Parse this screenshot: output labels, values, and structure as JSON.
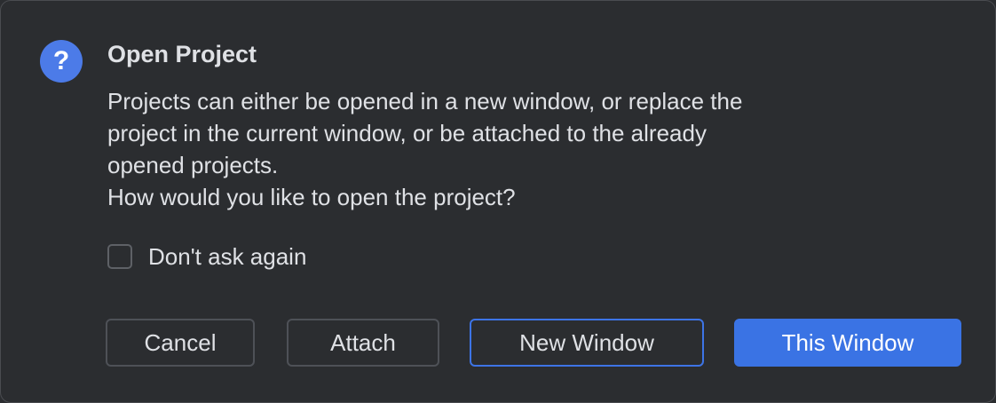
{
  "dialog": {
    "title": "Open Project",
    "icon": "question-icon",
    "icon_glyph": "?",
    "message_lines": [
      "Projects can either be opened in a new window, or replace the",
      "project in the current window, or be attached to the already",
      "opened projects.",
      "How would you like to open the project?"
    ],
    "checkbox": {
      "label": "Don't ask again",
      "checked": false
    },
    "buttons": {
      "cancel": "Cancel",
      "attach": "Attach",
      "new_window": "New Window",
      "this_window": "This Window"
    },
    "colors": {
      "background": "#2b2d30",
      "accent": "#3a73e4",
      "text": "#dfe1e5"
    }
  }
}
